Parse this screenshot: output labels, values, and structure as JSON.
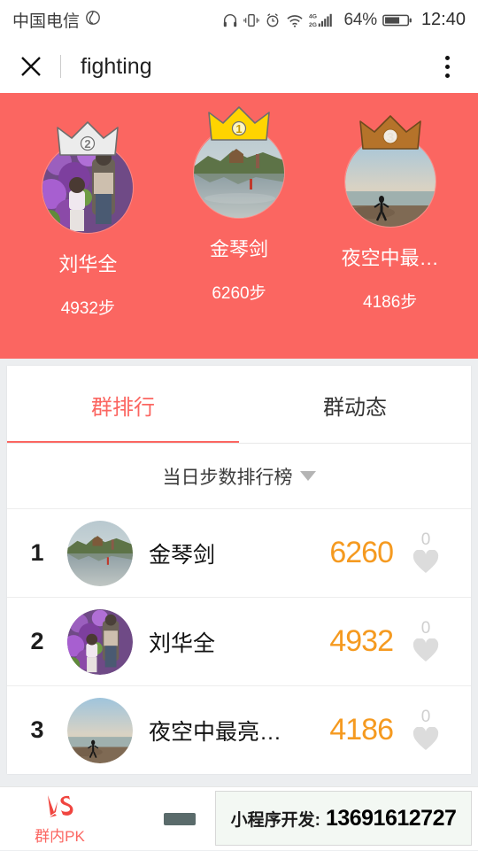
{
  "status_bar": {
    "carrier": "中国电信",
    "carrier_icon": "telecom-logo-icon",
    "icons": [
      "headphones-icon",
      "vibrate-icon",
      "alarm-clock-icon",
      "wifi-icon",
      "signal-4g-2g-icon"
    ],
    "battery_percent": "64%",
    "battery_icon": "battery-icon",
    "time": "12:40"
  },
  "title_bar": {
    "close_icon": "close-icon",
    "title": "fighting",
    "more_icon": "more-vertical-icon"
  },
  "podium": {
    "background_color": "#fb6661",
    "entries": [
      {
        "rank": "2",
        "crown": "silver-crown-icon",
        "crown_color": "#e3e3e3",
        "name": "刘华全",
        "steps": "4932步"
      },
      {
        "rank": "1",
        "crown": "gold-crown-icon",
        "crown_color": "#ffd400",
        "name": "金琴剑",
        "steps": "6260步"
      },
      {
        "rank": "3",
        "crown": "bronze-crown-icon",
        "crown_color": "#b5732a",
        "name": "夜空中最…",
        "steps": "4186步"
      }
    ]
  },
  "tabs": {
    "items": [
      {
        "label": "群排行",
        "active": true
      },
      {
        "label": "群动态",
        "active": false
      }
    ],
    "active_color": "#fb6661"
  },
  "rank_filter": {
    "label": "当日步数排行榜",
    "caret_icon": "chevron-down-icon"
  },
  "rank_list": {
    "step_color": "#f59a20",
    "rows": [
      {
        "rank": "1",
        "name": "金琴剑",
        "steps": "6260",
        "likes": "0",
        "like_icon": "heart-icon"
      },
      {
        "rank": "2",
        "name": "刘华全",
        "steps": "4932",
        "likes": "0",
        "like_icon": "heart-icon"
      },
      {
        "rank": "3",
        "name": "夜空中最亮…",
        "steps": "4186",
        "likes": "0",
        "like_icon": "heart-icon"
      }
    ]
  },
  "bottom_bar": {
    "items": [
      {
        "label": "群内PK",
        "icon": "vs-logo-icon",
        "color": "#fb6661"
      }
    ]
  },
  "overlay_note": {
    "label": "小程序开发:",
    "phone": "13691612727"
  }
}
